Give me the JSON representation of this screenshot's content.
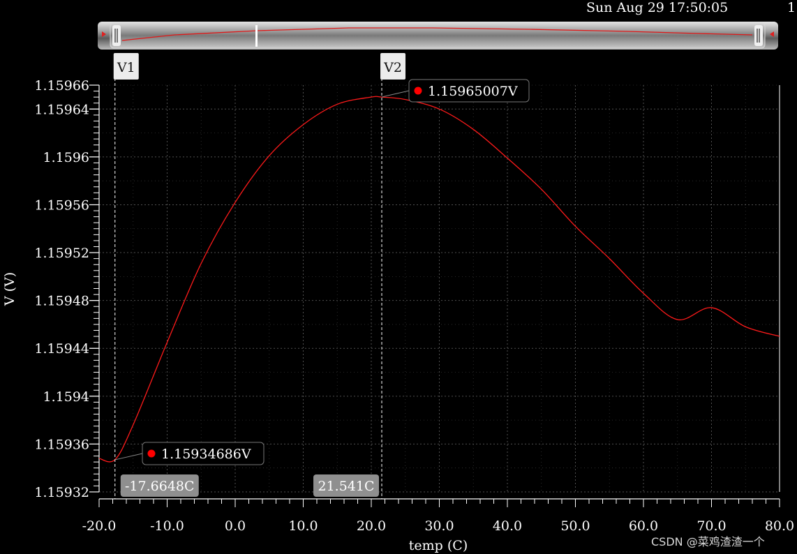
{
  "header": {
    "datetime": "Sun Aug 29 17:50:05",
    "page_num": "1"
  },
  "cursors": [
    {
      "name": "V1",
      "x": -17.6648,
      "x_label": "-17.6648C",
      "y_label": "1.15934686V",
      "y": 1.15934686
    },
    {
      "name": "V2",
      "x": 21.541,
      "x_label": "21.541C",
      "y_label": "1.15965007V",
      "y": 1.15965007
    }
  ],
  "watermark": "CSDN @菜鸡渣渣一个",
  "colors": {
    "background": "#000000",
    "trace": "#ff1a1a",
    "grid": "#5a5a5a",
    "marker": "#ff0000"
  },
  "chart_data": {
    "type": "line",
    "xlabel": "temp (C)",
    "ylabel": "V (V)",
    "xlim": [
      -20.0,
      80.0
    ],
    "ylim": [
      1.15932,
      1.15966
    ],
    "x_ticks": [
      -20.0,
      -10.0,
      0.0,
      10.0,
      20.0,
      30.0,
      40.0,
      50.0,
      60.0,
      70.0,
      80.0
    ],
    "x_tick_labels": [
      "-20.0",
      "-10.0",
      "0.0",
      "10.0",
      "20.0",
      "30.0",
      "40.0",
      "50.0",
      "60.0",
      "70.0",
      "80.0"
    ],
    "y_ticks": [
      1.15932,
      1.15936,
      1.1594,
      1.15944,
      1.15948,
      1.15952,
      1.15956,
      1.1596,
      1.15964,
      1.15966
    ],
    "y_tick_labels": [
      "1.15932",
      "1.15936",
      "1.1594",
      "1.15944",
      "1.15948",
      "1.15952",
      "1.15956",
      "1.1596",
      "1.15964",
      "1.15966"
    ],
    "grid": true,
    "series": [
      {
        "x": [
          -20.0,
          -17.66,
          -15.0,
          -10.0,
          -5.0,
          0.0,
          5.0,
          10.0,
          15.0,
          20.0,
          21.54,
          25.0,
          30.0,
          35.0,
          40.0,
          45.0,
          50.0,
          55.0,
          60.0,
          65.0,
          70.0,
          75.0,
          80.0
        ],
        "y": [
          1.159348,
          1.159347,
          1.159376,
          1.159445,
          1.159511,
          1.159562,
          1.159601,
          1.159627,
          1.159644,
          1.15965,
          1.15965,
          1.159648,
          1.15964,
          1.159623,
          1.159599,
          1.159573,
          1.159542,
          1.159515,
          1.159486,
          1.159464,
          1.159474,
          1.159458,
          1.15945
        ]
      }
    ]
  }
}
